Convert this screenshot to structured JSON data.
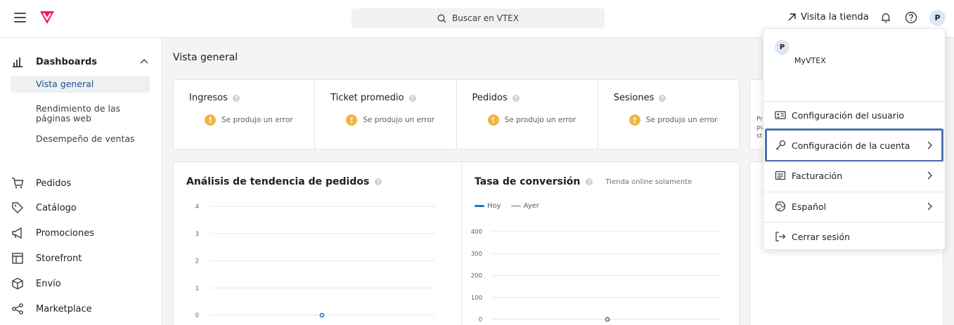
{
  "topbar": {
    "search_placeholder": "Buscar en VTEX",
    "visit_store": "Visita la tienda",
    "avatar_initial": "P"
  },
  "sidebar": {
    "dashboards": "Dashboards",
    "sub_items": [
      "Vista general",
      "Rendimiento de las páginas web",
      "Desempeño de ventas"
    ],
    "items": [
      "Pedidos",
      "Catálogo",
      "Promociones",
      "Storefront",
      "Envío",
      "Marketplace"
    ]
  },
  "main": {
    "title": "Vista general",
    "kpis": [
      {
        "label": "Ingresos",
        "error": "Se produjo un error"
      },
      {
        "label": "Ticket promedio",
        "error": "Se produjo un error"
      },
      {
        "label": "Pedidos",
        "error": "Se produjo un error"
      },
      {
        "label": "Sesiones",
        "error": "Se produjo un error"
      }
    ],
    "partial_card_text": [
      "Pr",
      "pu",
      "st"
    ]
  },
  "charts": {
    "orders_trend": {
      "title": "Análisis de tendencia de pedidos",
      "y_ticks": [
        "4",
        "3",
        "2",
        "1",
        "0"
      ]
    },
    "conversion": {
      "title": "Tasa de conversión",
      "subtitle": "Tienda online solamente",
      "legend": [
        "Hoy",
        "Ayer"
      ],
      "y_ticks": [
        "400",
        "300",
        "200",
        "100",
        "0"
      ]
    }
  },
  "chart_data": [
    {
      "type": "line",
      "title": "Análisis de tendencia de pedidos",
      "ylim": [
        0,
        4
      ],
      "series": [
        {
          "values": [
            0
          ]
        }
      ]
    },
    {
      "type": "line",
      "title": "Tasa de conversión",
      "ylim": [
        0,
        400
      ],
      "series": [
        {
          "name": "Hoy",
          "values": [
            0
          ]
        },
        {
          "name": "Ayer",
          "values": []
        }
      ]
    }
  ],
  "menu": {
    "avatar_initial": "P",
    "account": "MyVTEX",
    "items": {
      "user_config": "Configuración del usuario",
      "account_config": "Configuración de la cuenta",
      "billing": "Facturación",
      "language": "Español",
      "logout": "Cerrar sesión"
    }
  },
  "colors": {
    "accent": "#f71963",
    "highlight": "#4a72b0",
    "series_today": "#2a6ebb",
    "series_yesterday": "#c4c6c8",
    "warning": "#f4b342"
  }
}
